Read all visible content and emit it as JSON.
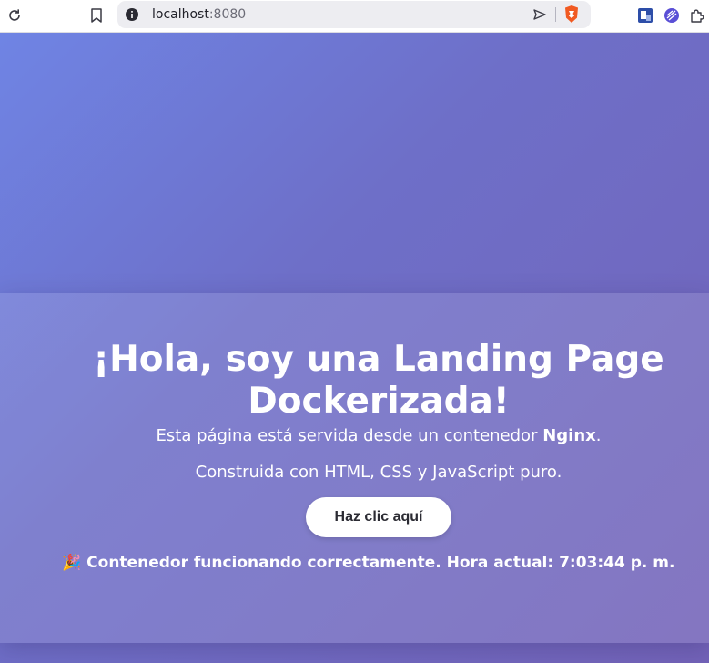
{
  "browser": {
    "url_host": "localhost",
    "url_port": ":8080",
    "icons": [
      "reload-icon",
      "bookmark-icon",
      "site-info-icon",
      "send-icon",
      "brave-shield-icon",
      "extension-app-icon",
      "extension-vpn-icon",
      "extensions-puzzle-icon"
    ]
  },
  "colors": {
    "gradient_start": "#6f84e4",
    "gradient_end": "#7363b8",
    "button_bg": "#ffffff",
    "text": "#ffffff"
  },
  "hero": {
    "title": "¡Hola, soy una Landing Page Dockerizada!",
    "line1_before": "Esta página está servida desde un contenedor ",
    "line1_bold": "Nginx",
    "line1_after": ".",
    "line2": "Construida con HTML, CSS y JavaScript puro.",
    "button_label": "Haz clic aquí",
    "status_emoji": "🎉",
    "status_text": "Contenedor funcionando correctamente. Hora actual: 7:03:44 p. m."
  }
}
